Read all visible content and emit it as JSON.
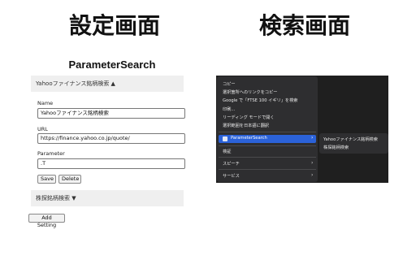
{
  "headings": {
    "settings": "設定画面",
    "search": "検索画面"
  },
  "settings_panel": {
    "title": "ParameterSearch",
    "yahoo_section": {
      "header": "Yahooファイナンス銘柄検索 ▲",
      "name_label": "Name",
      "name_value": "Yahooファイナンス銘柄検索",
      "url_label": "URL",
      "url_value": "https://finance.yahoo.co.jp/quote/",
      "parameter_label": "Parameter",
      "parameter_value": ".T",
      "save_label": "Save",
      "delete_label": "Delete"
    },
    "kabu_section": {
      "header": "株探銘柄検索 ▼"
    },
    "add_setting_label": "Add Setting"
  },
  "context_menu": {
    "items": [
      "コピー",
      "選択箇所へのリンクをコピー",
      "Google で「FTSE 100 イギリ」を検索",
      "印刷...",
      "リーディング モードで開く",
      "選択範囲を日本語に翻訳"
    ],
    "highlighted": "ParameterSearch",
    "inspect": "検証",
    "speech": "スピーチ",
    "services": "サービス",
    "chevron": "›",
    "submenu": [
      "Yahooファイナンス銘柄検索",
      "株探銘柄検索"
    ]
  }
}
